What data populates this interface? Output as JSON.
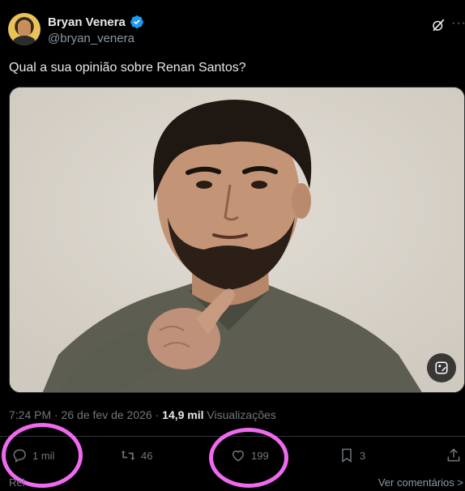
{
  "author": {
    "name": "Bryan Venera",
    "handle": "@bryan_venera"
  },
  "tweet": {
    "text": "Qual a sua opinião sobre Renan Santos?",
    "time": "7:24 PM",
    "date": "26 de fev de 2026",
    "separator": "·",
    "views_count": "14,9 mil",
    "views_label": "Visualizações"
  },
  "actions": {
    "replies": "1 mil",
    "retweets": "46",
    "likes": "199",
    "bookmarks": "3"
  },
  "footer": {
    "left_partial": "Rel",
    "right": "Ver comentários",
    "right_chevron": ">"
  },
  "colors": {
    "background": "#000000",
    "verified": "#1d9bf0",
    "highlight": "#f06af0",
    "muted": "#71767b"
  },
  "icons": [
    "verified-badge-icon",
    "grok-icon",
    "more-icon",
    "image-edit-icon",
    "reply-icon",
    "retweet-icon",
    "like-icon",
    "bookmark-icon",
    "share-icon"
  ]
}
